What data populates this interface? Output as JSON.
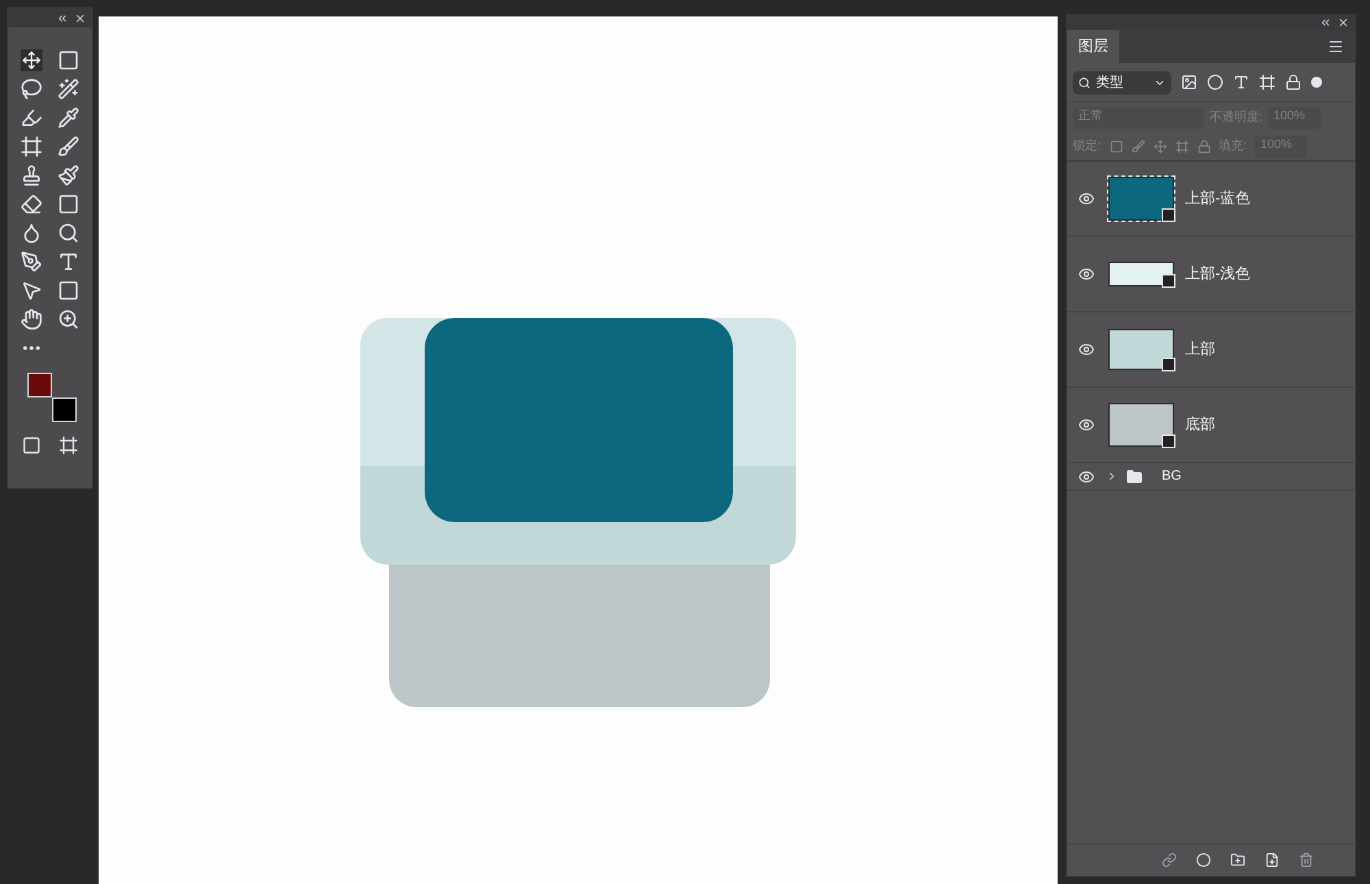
{
  "layers_panel": {
    "tab": {
      "label": "图层",
      "selected": true
    },
    "filter": {
      "value": "类型"
    },
    "blend_mode": {
      "value": "正常",
      "disabled": true
    },
    "opacity": {
      "label": "不透明度:",
      "value": "100%",
      "disabled": true
    },
    "lock": {
      "label": "锁定:"
    },
    "fill": {
      "label": "填充:",
      "value": "100%",
      "disabled": true
    },
    "layers": [
      {
        "name": "上部-蓝色",
        "visible": true,
        "color": "#0b687f",
        "kind": "blue"
      },
      {
        "name": "上部-浅色",
        "visible": true,
        "color": "#e3f1f1",
        "kind": "light"
      },
      {
        "name": "上部",
        "visible": true,
        "color": "#c2d8d8",
        "kind": "mid"
      },
      {
        "name": "底部",
        "visible": true,
        "color": "#bcc6c8",
        "kind": "base"
      }
    ],
    "group": {
      "name": "BG",
      "visible": true,
      "expanded": false
    }
  }
}
